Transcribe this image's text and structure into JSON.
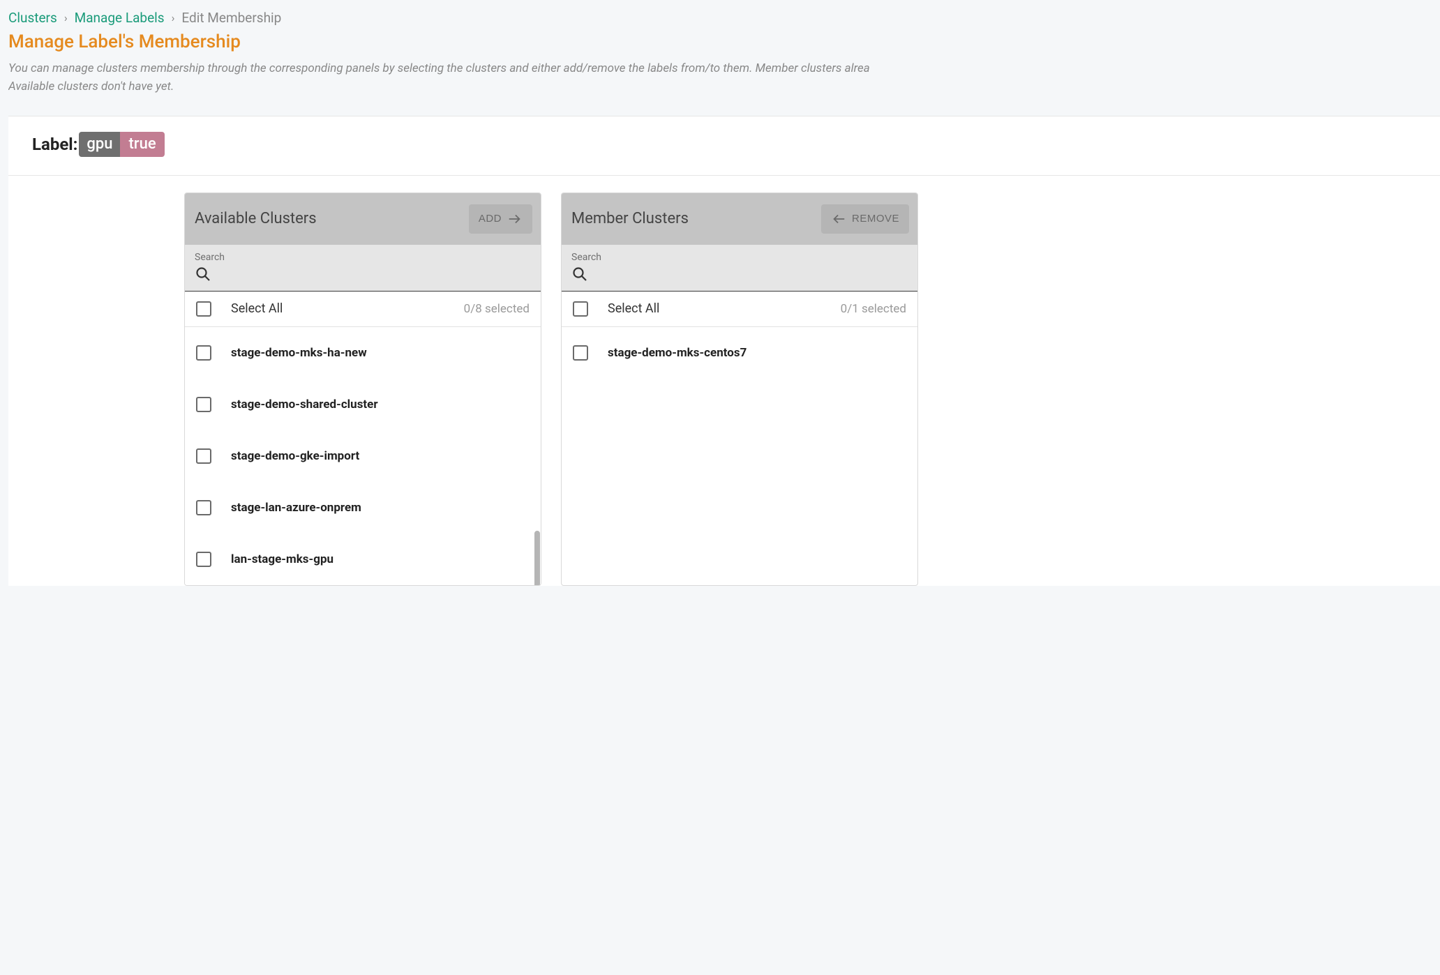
{
  "breadcrumb": {
    "level1": "Clusters",
    "level2": "Manage Labels",
    "current": "Edit Membership"
  },
  "title": "Manage Label's Membership",
  "subtitle_line1": "You can manage clusters membership through the corresponding panels by selecting the clusters and either add/remove the labels from/to them. Member clusters alrea",
  "subtitle_line2": "Available clusters don't have yet.",
  "label": {
    "prefix": "Label:",
    "key": "gpu",
    "value": "true"
  },
  "available": {
    "title": "Available Clusters",
    "action": "Add",
    "search_label": "Search",
    "search_value": "",
    "select_all": "Select All",
    "selected_count": "0/8 selected",
    "items": [
      "stage-demo-mks-ha-new",
      "stage-demo-shared-cluster",
      "stage-demo-gke-import",
      "stage-lan-azure-onprem",
      "lan-stage-mks-gpu"
    ]
  },
  "member": {
    "title": "Member Clusters",
    "action": "Remove",
    "search_label": "Search",
    "search_value": "",
    "select_all": "Select All",
    "selected_count": "0/1 selected",
    "items": [
      "stage-demo-mks-centos7"
    ]
  }
}
